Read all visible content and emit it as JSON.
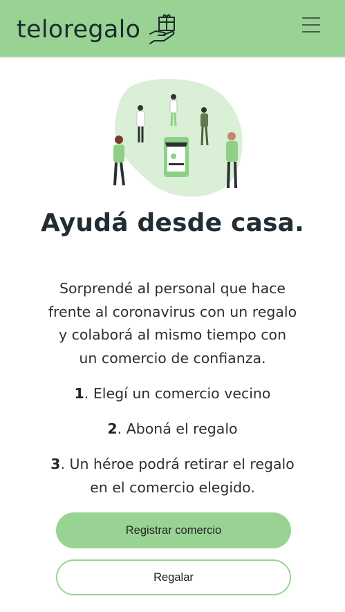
{
  "header": {
    "brand_name": "teloregalo",
    "brand_icon": "hand-holding-gift-icon",
    "menu_icon": "hamburger-menu-icon",
    "background_color": "#99d394"
  },
  "hero": {
    "illustration": "community-shop-illustration",
    "title": "Ayudá desde casa."
  },
  "intro": {
    "lines": [
      "Sorprendé al personal que hace",
      "frente al coronavirus con un regalo",
      "y colaborá al mismo tiempo con",
      "un comercio de confianza."
    ]
  },
  "steps": [
    {
      "number": "1",
      "lines": [
        ". Elegí un comercio vecino"
      ]
    },
    {
      "number": "2",
      "lines": [
        ". Aboná el regalo"
      ]
    },
    {
      "number": "3",
      "lines": [
        ". Un héroe podrá retirar el regalo",
        "en el comercio elegido."
      ]
    }
  ],
  "actions": {
    "register_label": "Registrar comercio",
    "gift_label": "Regalar",
    "accent_color": "#99d394"
  }
}
